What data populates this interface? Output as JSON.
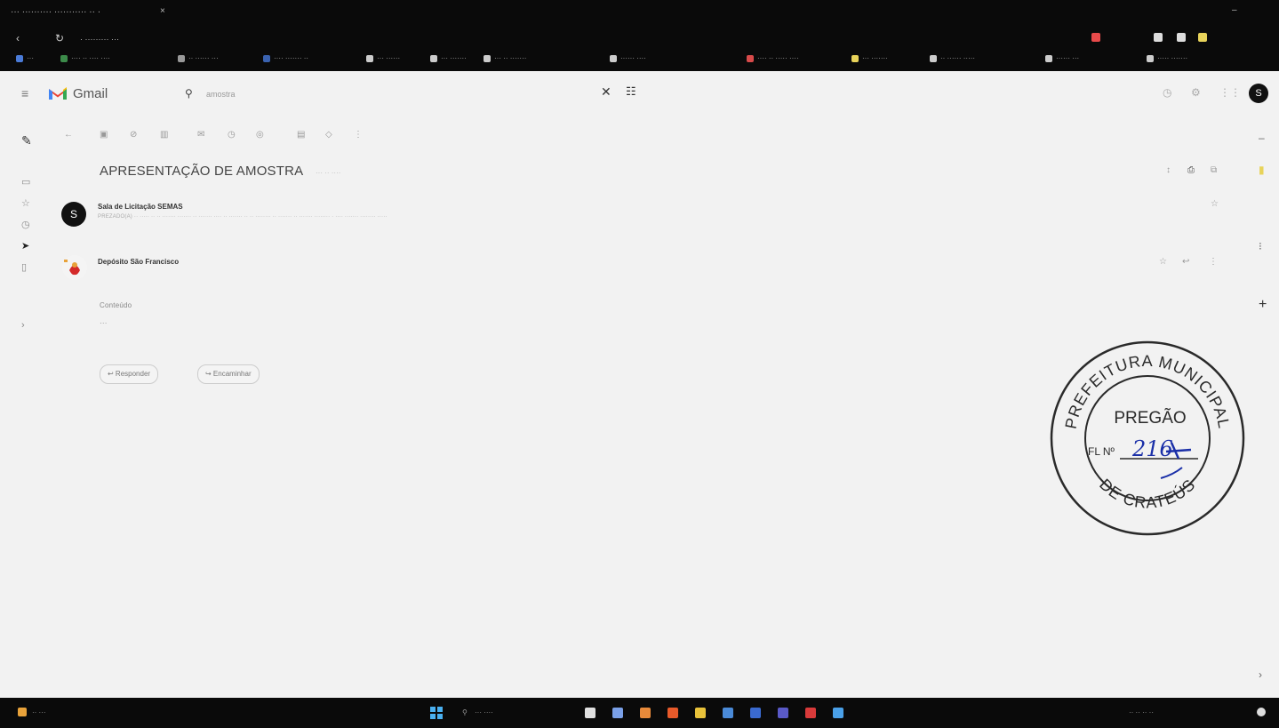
{
  "browser": {
    "tab_title": "··· ·········· ··········· ·· ·",
    "tab_close": "×",
    "url": "· ········· ···",
    "back": "‹",
    "reload": "↻",
    "win_min": "–",
    "bookmarks": [
      {
        "label": "···",
        "color": "#4a7bd8"
      },
      {
        "label": "···· ·· ···· ····",
        "color": "#3c8b4a"
      },
      {
        "label": "·· ······ ···",
        "color": "#999999"
      },
      {
        "label": "···· ······· ··",
        "color": "#3a62b0"
      },
      {
        "label": "··· ······",
        "color": "#cccccc"
      },
      {
        "label": "··· ·······",
        "color": "#cccccc"
      },
      {
        "label": "··· ·· ·······",
        "color": "#cccccc"
      },
      {
        "label": "······ ····",
        "color": "#cccccc"
      },
      {
        "label": "···· ·· ····· ····",
        "color": "#d84a4a"
      },
      {
        "label": "··· ·······",
        "color": "#e8d35a"
      },
      {
        "label": "·· ······ ·····",
        "color": "#cccccc"
      },
      {
        "label": "······ ···",
        "color": "#cccccc"
      },
      {
        "label": "····· ·······",
        "color": "#cccccc"
      }
    ]
  },
  "gmail": {
    "brand": "Gmail",
    "menu_icon": "≡",
    "search_icon": "⚲",
    "search_value": "amostra",
    "clear_icon": "✕",
    "filter_icon": "☷",
    "avatar_letter": "S"
  },
  "thread": {
    "subject": "APRESENTAÇÃO DE AMOSTRA",
    "subject_tag": "··· ·· ····",
    "messages": [
      {
        "avatar_letter": "S",
        "sender": "Sala de Licitação SEMAS",
        "snippet": "PREZADO(A) ·· ····· ·· ·· ······· ······· ·· ······· ···· ·· ······· ·· ·· ········ ·· ······· ·· ······· ········ · ···· ······· ········ ·····"
      },
      {
        "avatar_letter": "",
        "sender": "Depósito São Francisco",
        "snippet": ""
      }
    ],
    "expand_label": "Conteúdo",
    "ellipsis": "···",
    "reply_label": "↩ Responder",
    "forward_label": "↪ Encaminhar"
  },
  "stamp": {
    "top_text": "PREFEITURA MUNICIPAL",
    "bottom_text": "DE CRATEÚS",
    "center_label": "PREGÃO",
    "field_label": "FL Nº",
    "handwritten_number": "216"
  },
  "taskbar": {
    "weather": "·· ···",
    "search_placeholder": "··· ····",
    "tray_text": "·· ·· ·· ··",
    "apps": [
      {
        "name": "chrome",
        "color": "#e0e0e0"
      },
      {
        "name": "chat",
        "color": "#7aa0e8"
      },
      {
        "name": "paint",
        "color": "#e88a3a"
      },
      {
        "name": "firefox",
        "color": "#e85a2a"
      },
      {
        "name": "explorer",
        "color": "#e8c23a"
      },
      {
        "name": "store",
        "color": "#4a8ad8"
      },
      {
        "name": "outlook",
        "color": "#3a6ad0"
      },
      {
        "name": "teams",
        "color": "#5a5ac8"
      },
      {
        "name": "acrobat",
        "color": "#d83a3a"
      },
      {
        "name": "app10",
        "color": "#4aa0e8"
      }
    ]
  },
  "colors": {
    "gmail_red": "#ea4335",
    "stamp_ink": "#2a2a2a",
    "handwriting_ink": "#1a2fa8"
  }
}
